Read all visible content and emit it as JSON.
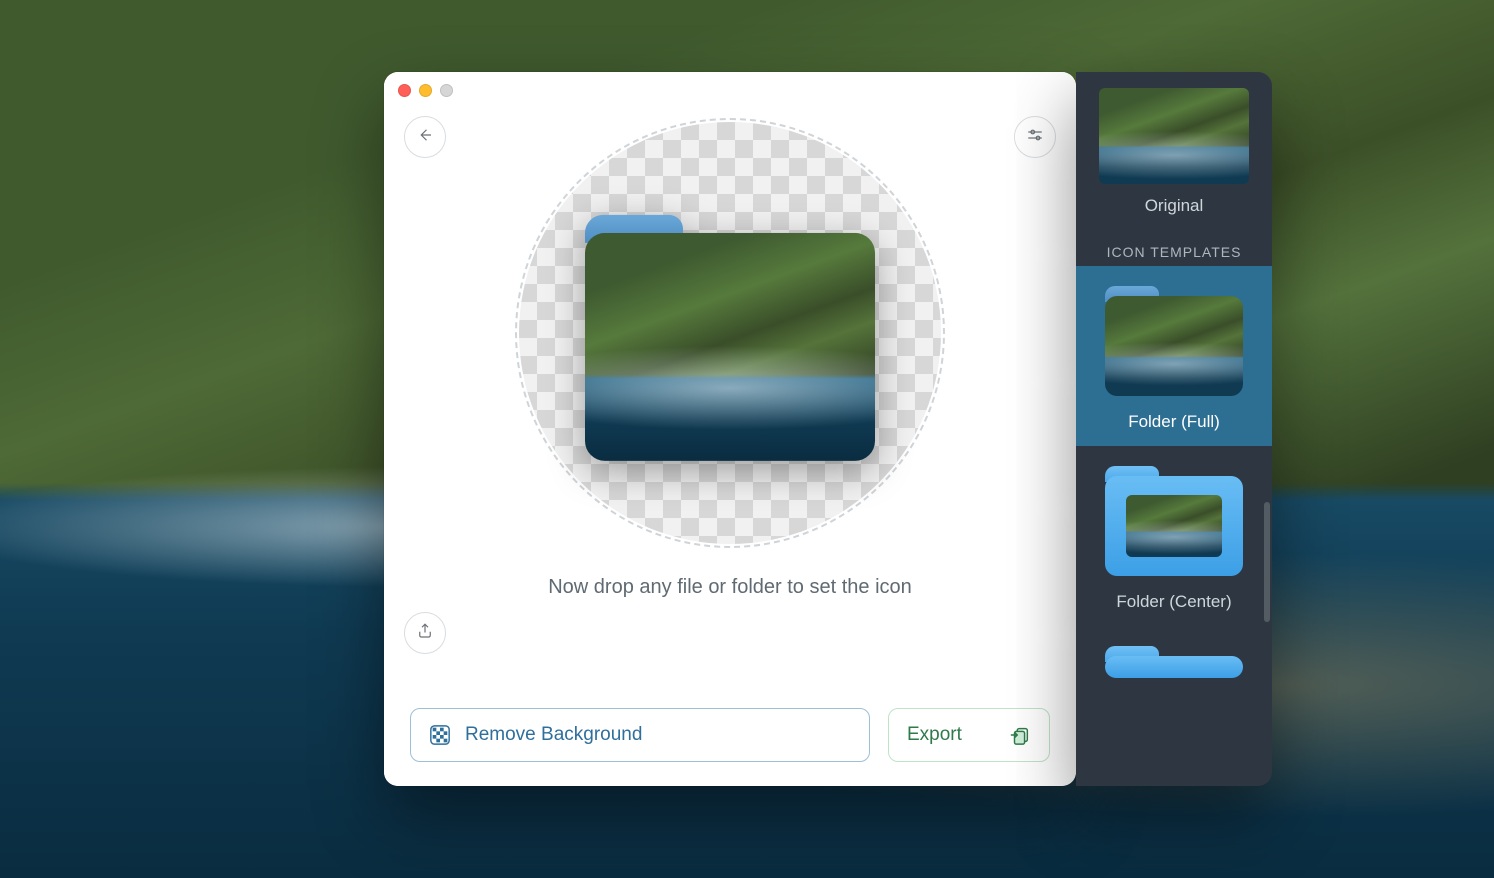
{
  "window": {
    "back_tooltip": "Back",
    "settings_tooltip": "Settings",
    "share_tooltip": "Share"
  },
  "main": {
    "drop_hint": "Now drop any file or folder to set the icon",
    "remove_bg_label": "Remove Background",
    "export_label": "Export"
  },
  "sidebar": {
    "original_label": "Original",
    "templates_heading": "ICON TEMPLATES",
    "items": [
      {
        "label": "Folder (Full)",
        "selected": true
      },
      {
        "label": "Folder (Center)",
        "selected": false
      }
    ]
  },
  "colors": {
    "accent_blue": "#2f6f9c",
    "accent_green": "#2f7a4a",
    "sidebar_bg": "#2e3741",
    "selected_bg": "#2d6f92"
  }
}
